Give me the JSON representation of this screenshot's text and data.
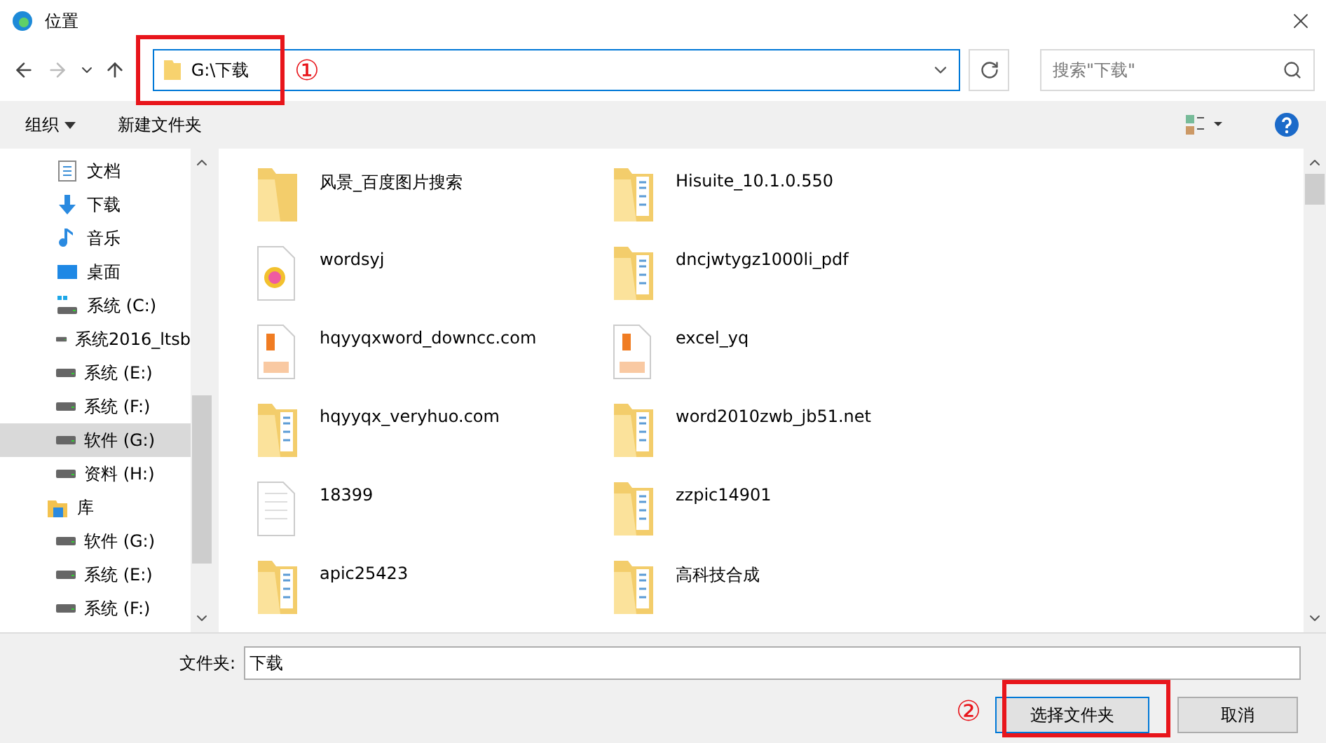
{
  "window": {
    "title": "位置"
  },
  "address": {
    "value": "G:\\下载"
  },
  "search": {
    "placeholder": "搜索\"下载\""
  },
  "toolbar": {
    "organize": "组织",
    "new_folder": "新建文件夹"
  },
  "sidebar": {
    "items": [
      {
        "label": "文档",
        "kind": "document",
        "selected": false
      },
      {
        "label": "下载",
        "kind": "download",
        "selected": false
      },
      {
        "label": "音乐",
        "kind": "music",
        "selected": false
      },
      {
        "label": "桌面",
        "kind": "desktop",
        "selected": false
      },
      {
        "label": "系统 (C:)",
        "kind": "system-drive",
        "selected": false
      },
      {
        "label": "系统2016_ltsb",
        "kind": "drive",
        "selected": false
      },
      {
        "label": "系统 (E:)",
        "kind": "drive",
        "selected": false
      },
      {
        "label": "系统 (F:)",
        "kind": "drive",
        "selected": false
      },
      {
        "label": "软件 (G:)",
        "kind": "drive",
        "selected": true
      },
      {
        "label": "资料 (H:)",
        "kind": "drive",
        "selected": false
      },
      {
        "label": "库",
        "kind": "library",
        "selected": false
      },
      {
        "label": "软件 (G:)",
        "kind": "drive",
        "selected": false
      },
      {
        "label": "系统 (E:)",
        "kind": "drive",
        "selected": false
      },
      {
        "label": "系统 (F:)",
        "kind": "drive",
        "selected": false
      }
    ]
  },
  "files": [
    {
      "name": "风景_百度图片搜索",
      "kind": "folder"
    },
    {
      "name": "Hisuite_10.1.0.550",
      "kind": "folder-docs"
    },
    {
      "name": "wordsyj",
      "kind": "image"
    },
    {
      "name": "dncjwtygz1000li_pdf",
      "kind": "folder-docs"
    },
    {
      "name": "hqyyqxword_downcc.com",
      "kind": "pdf"
    },
    {
      "name": "excel_yq",
      "kind": "pdf"
    },
    {
      "name": "hqyyqx_veryhuo.com",
      "kind": "folder-docs"
    },
    {
      "name": "word2010zwb_jb51.net",
      "kind": "folder-docs"
    },
    {
      "name": "18399",
      "kind": "blank"
    },
    {
      "name": "zzpic14901",
      "kind": "folder-docs"
    },
    {
      "name": "apic25423",
      "kind": "folder-docs"
    },
    {
      "name": "高科技合成",
      "kind": "folder-docs"
    }
  ],
  "folder_field": {
    "label": "文件夹:",
    "value": "下载"
  },
  "buttons": {
    "select": "选择文件夹",
    "cancel": "取消"
  },
  "annotations": [
    "①",
    "②"
  ]
}
